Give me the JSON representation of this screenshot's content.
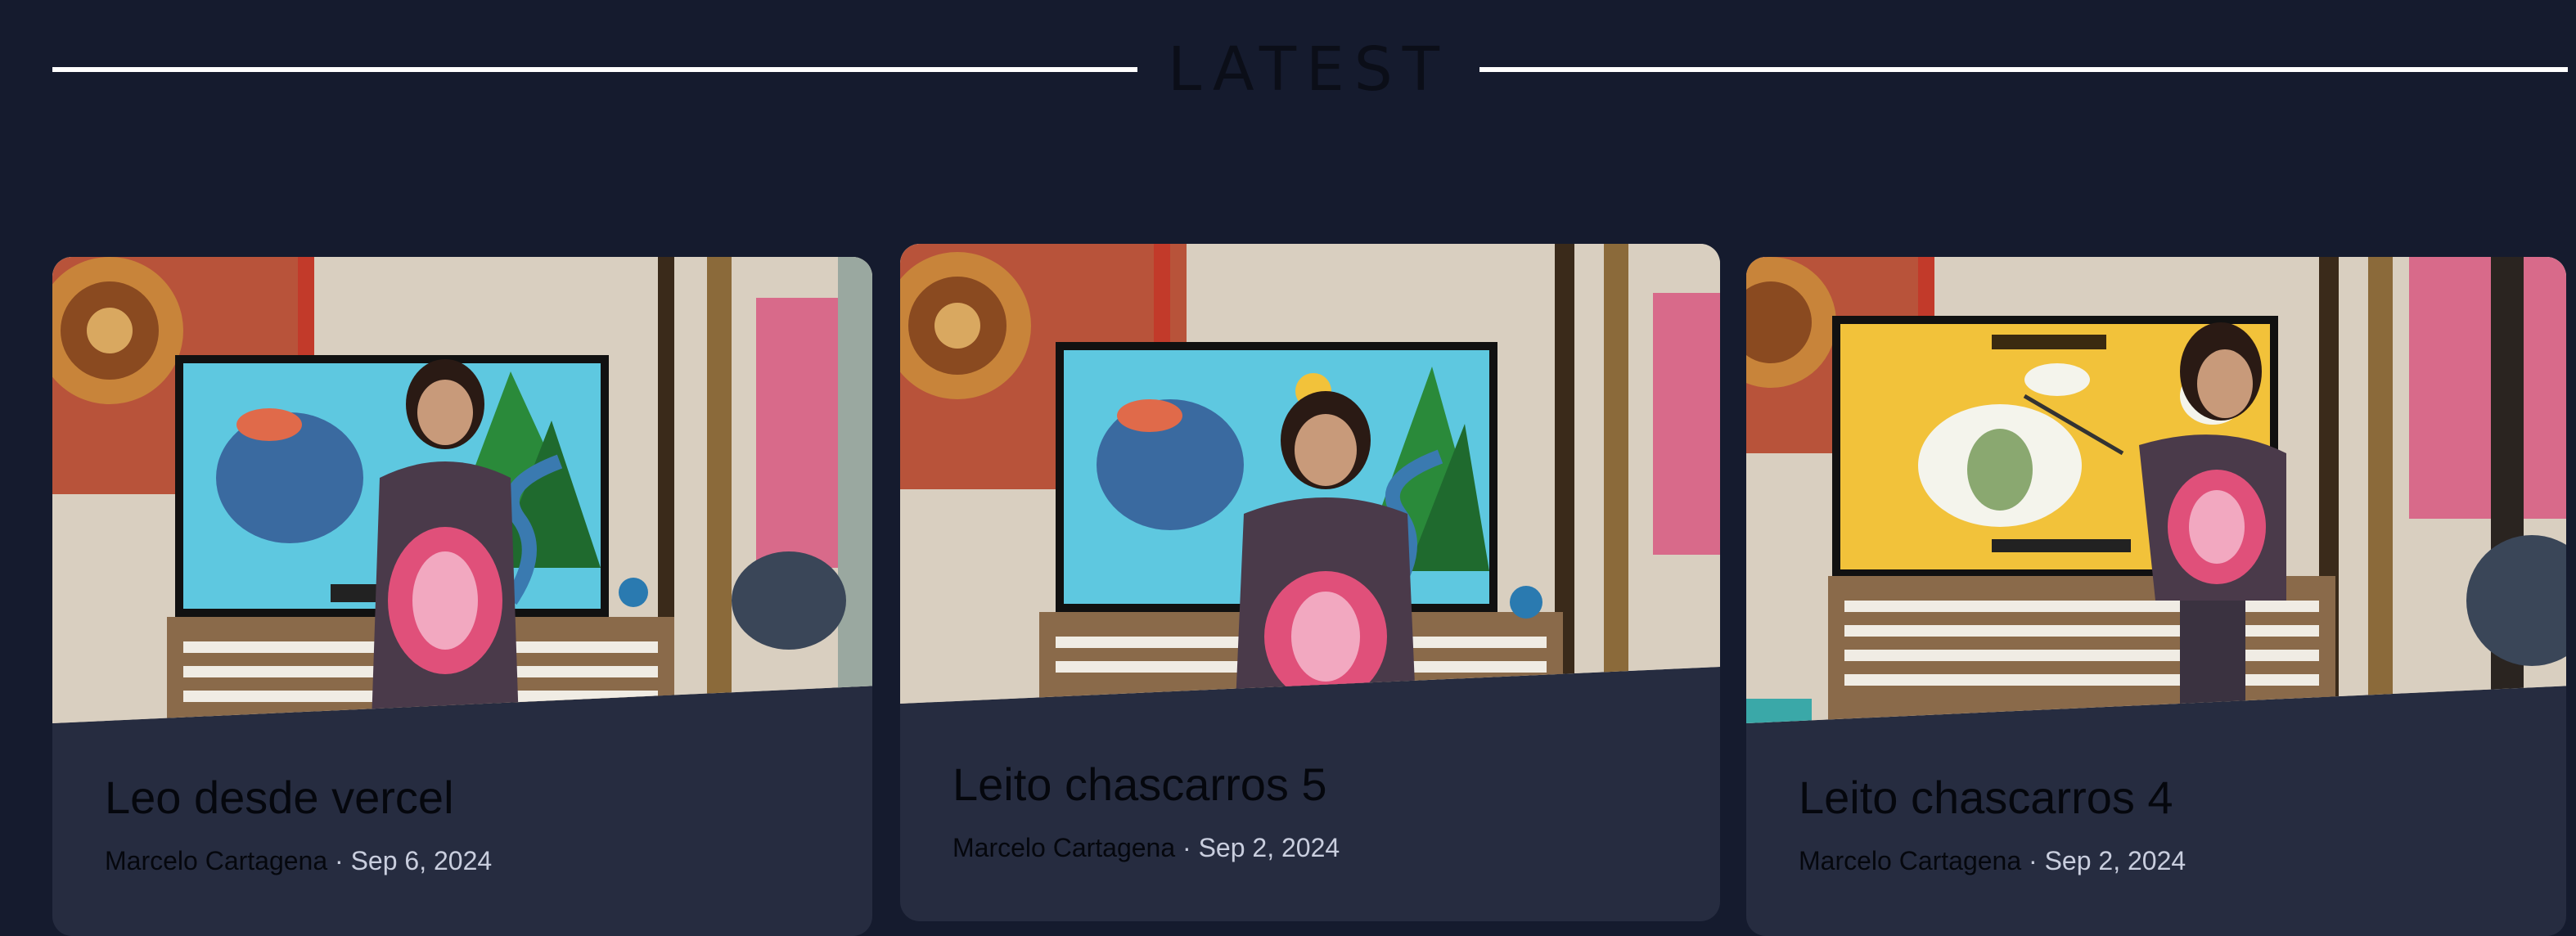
{
  "section": {
    "title": "LATEST"
  },
  "posts": [
    {
      "title": "Leo desde vercel",
      "author": "Marcelo Cartagena",
      "separator": " · ",
      "date": "Sep 6, 2024",
      "image_icon": "video-thumbnail"
    },
    {
      "title": "Leito chascarros 5",
      "author": "Marcelo Cartagena",
      "separator": " · ",
      "date": "Sep 2, 2024",
      "image_icon": "video-thumbnail"
    },
    {
      "title": "Leito chascarros 4",
      "author": "Marcelo Cartagena",
      "separator": " · ",
      "date": "Sep 2, 2024",
      "image_icon": "video-thumbnail"
    }
  ],
  "colors": {
    "background": "#151b2e",
    "card": "#262c40",
    "rule": "#ffffff"
  }
}
